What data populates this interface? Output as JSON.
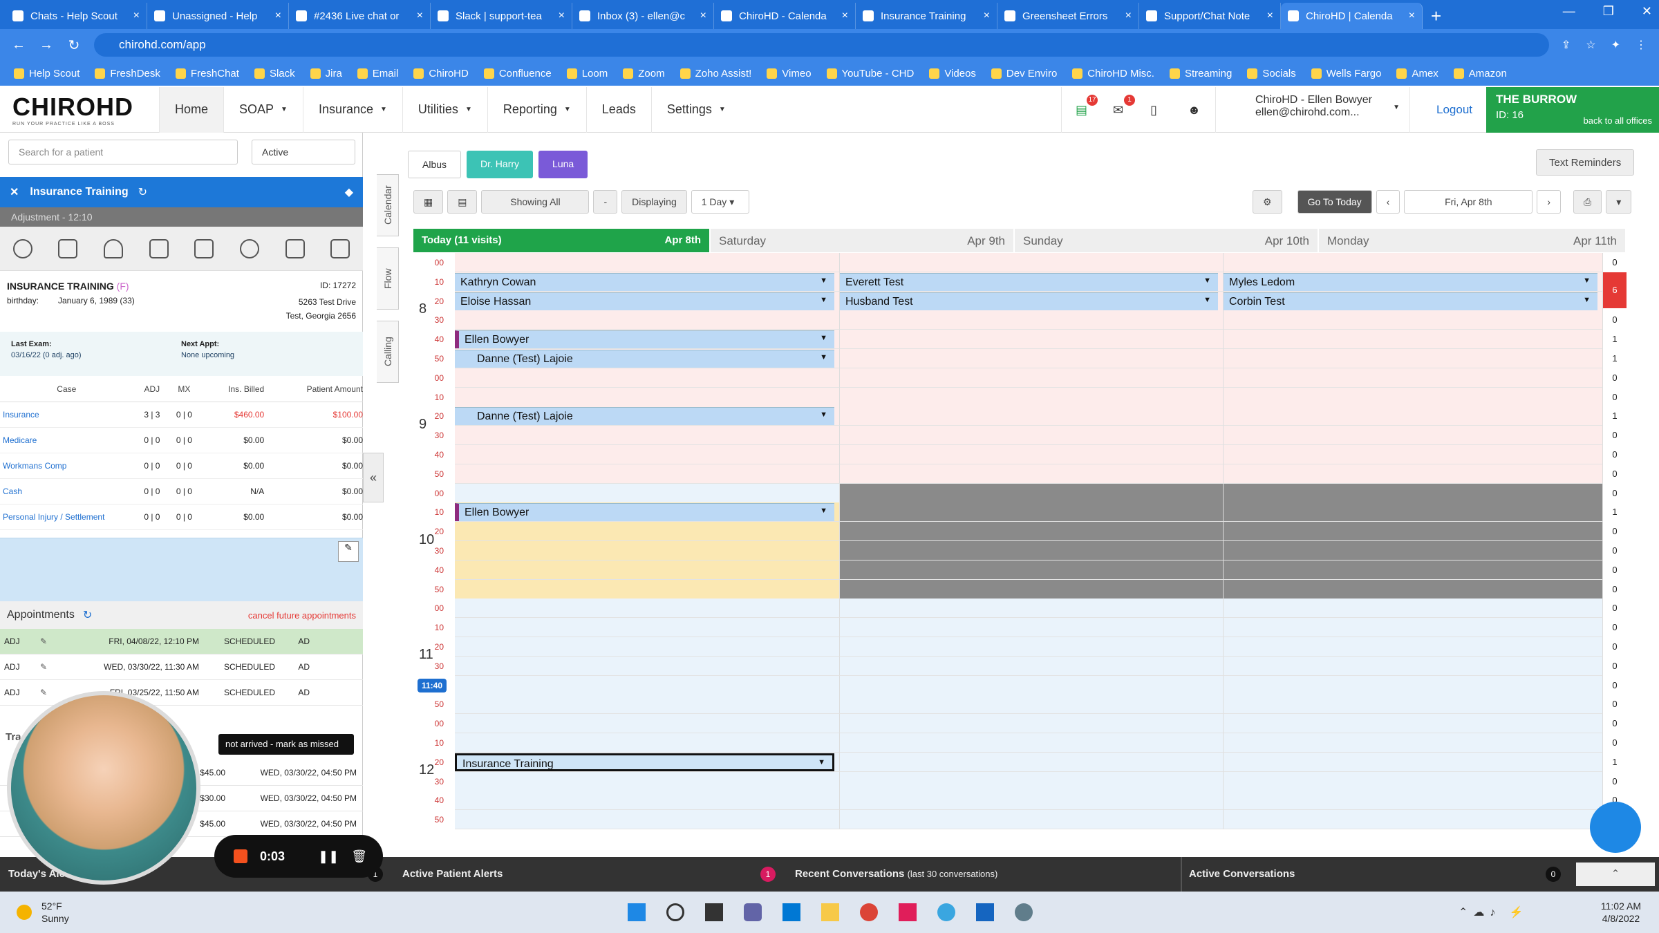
{
  "browser": {
    "tabs": [
      "Chats - Help Scout",
      "Unassigned - Help",
      "#2436 Live chat or",
      "Slack | support-tea",
      "Inbox (3) - ellen@c",
      "ChiroHD - Calenda",
      "Insurance Training",
      "Greensheet Errors",
      "Support/Chat Note",
      "ChiroHD | Calenda"
    ],
    "url": "chirohd.com/app",
    "bookmarks": [
      "Help Scout",
      "FreshDesk",
      "FreshChat",
      "Slack",
      "Jira",
      "Email",
      "ChiroHD",
      "Confluence",
      "Loom",
      "Zoom",
      "Zoho Assist!",
      "Vimeo",
      "YouTube - CHD",
      "Videos",
      "Dev Enviro",
      "ChiroHD Misc.",
      "Streaming",
      "Socials",
      "Wells Fargo",
      "Amex",
      "Amazon"
    ]
  },
  "app": {
    "logo": "CHIROHD",
    "tagline": "RUN YOUR PRACTICE LIKE A BOSS",
    "nav": {
      "home": "Home",
      "soap": "SOAP",
      "insurance": "Insurance",
      "utilities": "Utilities",
      "reporting": "Reporting",
      "leads": "Leads",
      "settings": "Settings"
    },
    "badges": {
      "messages": "17",
      "mail": "1"
    },
    "user": {
      "name": "ChiroHD - Ellen Bowyer",
      "email": "ellen@chirohd.com..."
    },
    "logout": "Logout",
    "office": {
      "name": "THE BURROW",
      "id": "ID: 16",
      "back": "back to all offices"
    }
  },
  "left": {
    "search_placeholder": "Search for a patient",
    "status": "Active",
    "patient_bar": "Insurance Training",
    "adjustment": "Adjustment - 12:10",
    "patient": {
      "name": "INSURANCE TRAINING",
      "flag": "(F)",
      "id": "ID: 17272",
      "birthday_label": "birthday:",
      "birthday": "January 6, 1989 (33)",
      "addr1": "5263 Test Drive",
      "addr2": "Test, Georgia 2656",
      "last_exam_label": "Last Exam:",
      "last_exam": "03/16/22 (0 adj. ago)",
      "next_appt_label": "Next Appt:",
      "next_appt": "None upcoming"
    },
    "case_headers": [
      "Case",
      "ADJ",
      "MX",
      "Ins. Billed",
      "Patient Amount"
    ],
    "cases": [
      {
        "case": "Insurance",
        "adj": "3 | 3",
        "mx": "0 | 0",
        "billed": "$460.00",
        "patient": "$100.00"
      },
      {
        "case": "Medicare",
        "adj": "0 | 0",
        "mx": "0 | 0",
        "billed": "$0.00",
        "patient": "$0.00"
      },
      {
        "case": "Workmans Comp",
        "adj": "0 | 0",
        "mx": "0 | 0",
        "billed": "$0.00",
        "patient": "$0.00"
      },
      {
        "case": "Cash",
        "adj": "0 | 0",
        "mx": "0 | 0",
        "billed": "N/A",
        "patient": "$0.00"
      },
      {
        "case": "Personal Injury / Settlement",
        "adj": "0 | 0",
        "mx": "0 | 0",
        "billed": "$0.00",
        "patient": "$0.00"
      }
    ],
    "appointments_title": "Appointments",
    "cancel_future": "cancel future appointments",
    "appointments": [
      {
        "type": "ADJ",
        "date": "FRI, 04/08/22, 12:10 PM",
        "status": "SCHEDULED",
        "who": "AD"
      },
      {
        "type": "ADJ",
        "date": "WED, 03/30/22, 11:30 AM",
        "status": "SCHEDULED",
        "who": "AD"
      },
      {
        "type": "ADJ",
        "date": "FRI, 03/25/22, 11:50 AM",
        "status": "SCHEDULED",
        "who": "AD"
      }
    ],
    "tooltip": "not arrived - mark as missed",
    "tx": [
      {
        "amt": "$45.00",
        "date": "WED, 03/30/22, 04:50 PM"
      },
      {
        "amt": "$30.00",
        "date": "WED, 03/30/22, 04:50 PM"
      },
      {
        "amt": "$45.00",
        "date": "WED, 03/30/22, 04:50 PM"
      }
    ],
    "tx_partial": "Tra"
  },
  "calendar": {
    "side_tabs": [
      "Calendar",
      "Flow",
      "Calling"
    ],
    "providers": [
      "Albus",
      "Dr. Harry",
      "Luna"
    ],
    "text_reminders": "Text Reminders",
    "showing_all": "Showing All",
    "minus": "-",
    "displaying": "Displaying",
    "range": "1 Day",
    "go_today": "Go To Today",
    "date": "Fri, Apr 8th",
    "days": [
      {
        "name": "Today (11 visits)",
        "date": "Apr 8th"
      },
      {
        "name": "Saturday",
        "date": "Apr 9th"
      },
      {
        "name": "Sunday",
        "date": "Apr 10th"
      },
      {
        "name": "Monday",
        "date": "Apr 11th"
      }
    ],
    "hours": [
      "8",
      "9",
      "10",
      "11",
      "12"
    ],
    "minutes": [
      "00",
      "10",
      "20",
      "30",
      "40",
      "50"
    ],
    "now": "11:40",
    "appointments": [
      {
        "name": "Kathryn Cowan",
        "col": 0,
        "slot": 1
      },
      {
        "name": "Eloise Hassan",
        "col": 0,
        "slot": 2
      },
      {
        "name": "Everett Test",
        "col": 1,
        "slot": 1
      },
      {
        "name": "Husband Test",
        "col": 1,
        "slot": 2
      },
      {
        "name": "Myles Ledom",
        "col": 2,
        "slot": 1
      },
      {
        "name": "Corbin Test",
        "col": 2,
        "slot": 2
      },
      {
        "name": "Ellen Bowyer",
        "col": 0,
        "slot": 4
      },
      {
        "name": "Danne (Test) Lajoie",
        "col": 0,
        "slot": 5
      },
      {
        "name": "Danne (Test) Lajoie",
        "col": 0,
        "slot": 8
      },
      {
        "name": "Ellen Bowyer",
        "col": 0,
        "slot": 13
      },
      {
        "name": "Insurance Training",
        "col": 0,
        "slot": 26
      }
    ],
    "counts": [
      "0",
      "6",
      "",
      "0",
      "1",
      "1",
      "0",
      "0",
      "1",
      "0",
      "0",
      "0",
      "0",
      "1",
      "0",
      "0",
      "0",
      "0",
      "0",
      "0",
      "0",
      "0",
      "0",
      "0",
      "0",
      "0",
      "1",
      "0",
      "0",
      "0"
    ]
  },
  "bottom": {
    "todays_alerts": "Today's Alerts",
    "alerts_count": "1",
    "active_patient_alerts": "Active Patient Alerts",
    "recent_conv_count": "1",
    "recent_conv": "Recent Conversations",
    "recent_conv_note": "(last 30 conversations)",
    "active_conv": "Active Conversations",
    "active_conv_count": "0"
  },
  "recording": {
    "time": "0:03"
  },
  "taskbar": {
    "temp": "52°F",
    "weather": "Sunny",
    "time": "11:02 AM",
    "date": "4/8/2022"
  }
}
